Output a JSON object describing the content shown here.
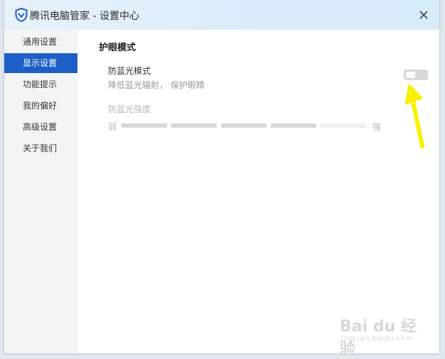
{
  "window": {
    "title": "腾讯电脑管家 - 设置中心",
    "logo_icon": "tencent-shield-icon",
    "close_icon": "close-icon"
  },
  "sidebar": {
    "items": [
      {
        "label": "通用设置",
        "active": false
      },
      {
        "label": "显示设置",
        "active": true
      },
      {
        "label": "功能提示",
        "active": false
      },
      {
        "label": "我的偏好",
        "active": false
      },
      {
        "label": "高级设置",
        "active": false
      },
      {
        "label": "关于我们",
        "active": false
      }
    ]
  },
  "main": {
    "section_title": "护眼模式",
    "blue_light": {
      "title": "防蓝光模式",
      "description": "降低蓝光辐射， 保护眼睛",
      "enabled": false
    },
    "intensity": {
      "label": "防蓝光强度",
      "min_label": "弱",
      "max_label": "强",
      "segments": 5,
      "enabled": false
    }
  },
  "annotation": {
    "arrow_icon": "yellow-arrow-icon",
    "color": "#f7f000"
  },
  "watermark": {
    "main": "Bai du 经验",
    "sub": "jingyan.baidu.com"
  },
  "colors": {
    "accent": "#1e5fc7",
    "sidebar_bg": "#f4f4f4",
    "toggle_off": "#d8d8d8"
  }
}
